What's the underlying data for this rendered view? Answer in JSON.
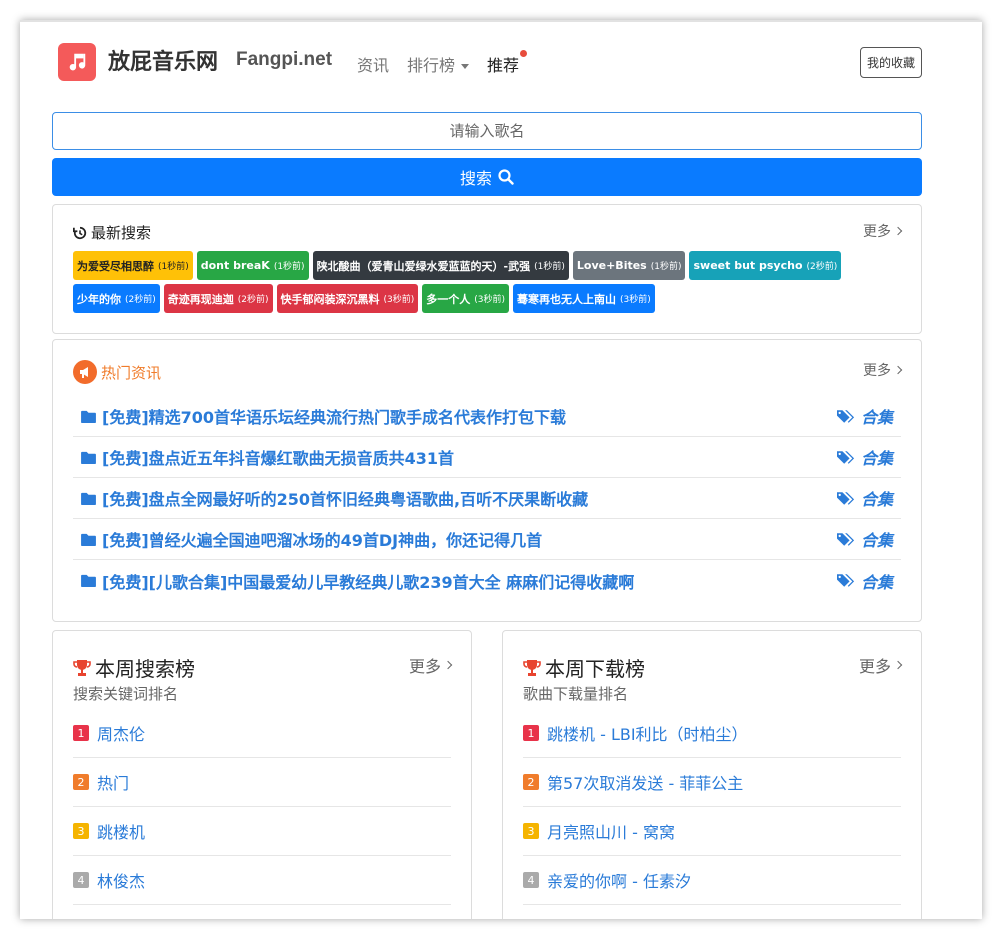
{
  "header": {
    "site_name": "放屁音乐网",
    "site_domain": "Fangpi.net",
    "nav": [
      {
        "label": "资讯"
      },
      {
        "label": "排行榜"
      },
      {
        "label": "推荐"
      }
    ],
    "favorites_label": "我的收藏"
  },
  "search": {
    "placeholder": "请输入歌名",
    "button_label": "搜索"
  },
  "recent": {
    "title": "最新搜索",
    "more": "更多",
    "tags": [
      {
        "text": "为爱受尽相思醉",
        "time": "(1秒前)",
        "color": "yellow"
      },
      {
        "text": "dont breaK",
        "time": "(1秒前)",
        "color": "green"
      },
      {
        "text": "陕北酸曲（爱青山爱绿水爱蓝蓝的天）-武强",
        "time": "(1秒前)",
        "color": "dark"
      },
      {
        "text": "Love+Bites",
        "time": "(1秒前)",
        "color": "gray"
      },
      {
        "text": "sweet but psycho",
        "time": "(2秒前)",
        "color": "teal"
      },
      {
        "text": "少年的你",
        "time": "(2秒前)",
        "color": "blue"
      },
      {
        "text": "奇迹再现迪迦",
        "time": "(2秒前)",
        "color": "red"
      },
      {
        "text": "快手郁闷装深沉黑料",
        "time": "(3秒前)",
        "color": "red"
      },
      {
        "text": "多一个人",
        "time": "(3秒前)",
        "color": "green"
      },
      {
        "text": "蓦寒再也无人上南山",
        "time": "(3秒前)",
        "color": "blue"
      }
    ]
  },
  "news": {
    "title": "热门资讯",
    "more": "更多",
    "items": [
      {
        "title": "[免费]精选700首华语乐坛经典流行热门歌手成名代表作打包下载",
        "tag": "合集"
      },
      {
        "title": "[免费]盘点近五年抖音爆红歌曲无损音质共431首",
        "tag": "合集"
      },
      {
        "title": "[免费]盘点全网最好听的250首怀旧经典粤语歌曲,百听不厌果断收藏",
        "tag": "合集"
      },
      {
        "title": "[免费]曾经火遍全国迪吧溜冰场的49首DJ神曲，你还记得几首",
        "tag": "合集"
      },
      {
        "title": "[免费][儿歌合集]中国最爱幼儿早教经典儿歌239首大全 麻麻们记得收藏啊",
        "tag": "合集"
      }
    ]
  },
  "weekly_search": {
    "title": "本周搜索榜",
    "subtitle": "搜索关键词排名",
    "more": "更多",
    "items": [
      {
        "rank": "1",
        "text": "周杰伦",
        "color": "#e8334a"
      },
      {
        "rank": "2",
        "text": "热门",
        "color": "#f07c2b"
      },
      {
        "rank": "3",
        "text": "跳楼机",
        "color": "#f5b400"
      },
      {
        "rank": "4",
        "text": "林俊杰",
        "color": "#aaaaaa"
      }
    ]
  },
  "weekly_download": {
    "title": "本周下载榜",
    "subtitle": "歌曲下载量排名",
    "more": "更多",
    "items": [
      {
        "rank": "1",
        "text": "跳楼机 - LBI利比（时柏尘）",
        "color": "#e8334a"
      },
      {
        "rank": "2",
        "text": "第57次取消发送 - 菲菲公主",
        "color": "#f07c2b"
      },
      {
        "rank": "3",
        "text": "月亮照山川 - 窝窝",
        "color": "#f5b400"
      },
      {
        "rank": "4",
        "text": "亲爱的你啊 - 任素汐",
        "color": "#aaaaaa"
      }
    ]
  },
  "colors": {
    "primary": "#0a7bff",
    "logo": "#f45a5a",
    "link": "#2a7bd8",
    "news_title": "#f07c2b"
  },
  "icons": {
    "logo": "music-note-icon",
    "search": "search-icon",
    "recent": "history-icon",
    "news": "megaphone-icon",
    "news_item": "folder-icon",
    "news_tag": "tags-icon",
    "rank": "trophy-icon"
  }
}
